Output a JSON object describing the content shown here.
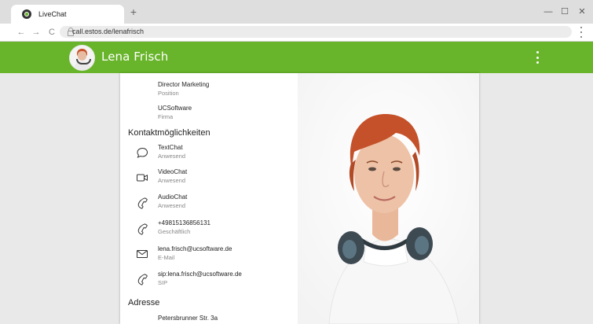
{
  "browser": {
    "tab_title": "LiveChat",
    "new_tab": "+",
    "url": "call.estos.de/lenafrisch",
    "window_controls": {
      "minimize": "—",
      "maximize": "☐",
      "close": "✕"
    },
    "nav": {
      "back": "←",
      "forward": "→",
      "reload": "C"
    }
  },
  "header": {
    "name": "Lena Frisch",
    "accent_color": "#68b42a"
  },
  "profile": {
    "position": {
      "value": "Director Marketing",
      "label": "Position"
    },
    "company": {
      "value": "UCSoftware",
      "label": "Firma"
    }
  },
  "contact": {
    "title": "Kontaktmöglichkeiten",
    "items": [
      {
        "icon": "chat-bubble-icon",
        "value": "TextChat",
        "label": "Anwesend"
      },
      {
        "icon": "video-camera-icon",
        "value": "VideoChat",
        "label": "Anwesend"
      },
      {
        "icon": "phone-icon",
        "value": "AudioChat",
        "label": "Anwesend"
      },
      {
        "icon": "phone-icon",
        "value": "+4981513685613​1",
        "label": "Geschäftlich"
      },
      {
        "icon": "mail-icon",
        "value": "lena.frisch@ucsoftware.de",
        "label": "E-Mail"
      },
      {
        "icon": "phone-icon",
        "value": "sip:lena.frisch@ucsoftware.de",
        "label": "SIP"
      }
    ]
  },
  "address": {
    "title": "Adresse",
    "street": "Petersbrunner Str. 3a"
  }
}
